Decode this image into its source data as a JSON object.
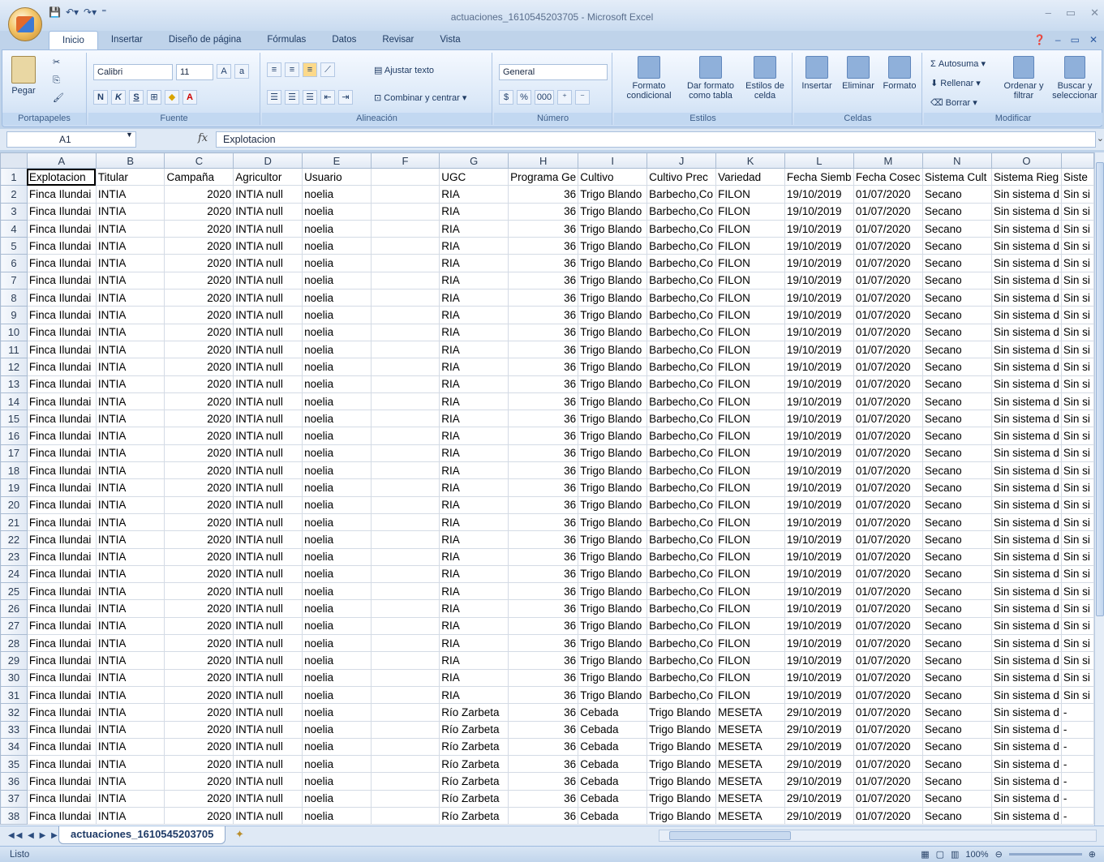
{
  "window": {
    "title": "actuaciones_1610545203705 - Microsoft Excel"
  },
  "ribbon_tabs": [
    "Inicio",
    "Insertar",
    "Diseño de página",
    "Fórmulas",
    "Datos",
    "Revisar",
    "Vista"
  ],
  "ribbon": {
    "portapapeles": {
      "label": "Portapapeles",
      "pegar": "Pegar"
    },
    "fuente": {
      "label": "Fuente",
      "font_name": "Calibri",
      "font_size": "11",
      "bold": "N",
      "italic": "K",
      "underline": "S"
    },
    "alineacion": {
      "label": "Alineación",
      "ajustar_texto": "Ajustar texto",
      "combinar": "Combinar y centrar"
    },
    "numero": {
      "label": "Número",
      "format": "General",
      "percent": "%",
      "thousands": "000"
    },
    "estilos": {
      "label": "Estilos",
      "formato_condicional": "Formato condicional",
      "dar_formato": "Dar formato como tabla",
      "estilos_celda": "Estilos de celda"
    },
    "celdas": {
      "label": "Celdas",
      "insertar": "Insertar",
      "eliminar": "Eliminar",
      "formato": "Formato"
    },
    "modificar": {
      "label": "Modificar",
      "autosuma": "Autosuma",
      "rellenar": "Rellenar",
      "borrar": "Borrar",
      "ordenar": "Ordenar y filtrar",
      "buscar": "Buscar y seleccionar"
    }
  },
  "formula_bar": {
    "cell_ref": "A1",
    "fx": "fx",
    "content": "Explotacion"
  },
  "columns": [
    "A",
    "B",
    "C",
    "D",
    "E",
    "F",
    "G",
    "H",
    "I",
    "J",
    "K",
    "L",
    "M",
    "N",
    "O",
    ""
  ],
  "header_row": [
    "Explotacion",
    "Titular",
    "Campaña",
    "Agricultor",
    "Usuario",
    "",
    "UGC",
    "Programa Ge",
    "Cultivo",
    "Cultivo Prec",
    "Variedad",
    "Fecha Siemb",
    "Fecha Cosec",
    "Sistema Cult",
    "Sistema Rieg",
    "Siste"
  ],
  "row_templates": {
    "a": [
      "Finca Ilundai",
      "INTIA",
      "2020",
      "INTIA null",
      "noelia",
      "",
      "RIA",
      "36",
      "Trigo Blando",
      "Barbecho,Co",
      "FILON",
      "19/10/2019",
      "01/07/2020",
      "Secano",
      "Sin sistema d",
      "Sin si"
    ],
    "b": [
      "Finca Ilundai",
      "INTIA",
      "2020",
      "INTIA null",
      "noelia",
      "",
      "Río Zarbeta",
      "36",
      "Cebada",
      "Trigo Blando",
      "MESETA",
      "29/10/2019",
      "01/07/2020",
      "Secano",
      "Sin sistema d",
      "-"
    ]
  },
  "rows_a_range": [
    2,
    31
  ],
  "rows_b_range": [
    32,
    38
  ],
  "sheet_tab": "actuaciones_1610545203705",
  "status": {
    "text": "Listo",
    "zoom": "100%"
  }
}
